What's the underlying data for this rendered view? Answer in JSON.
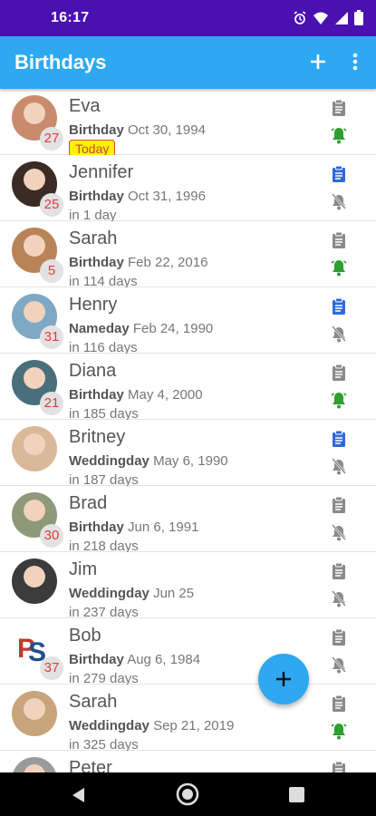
{
  "status": {
    "time": "16:17"
  },
  "app": {
    "title": "Birthdays"
  },
  "colors": {
    "appbar": "#2ea8f0",
    "statusbar": "#4a10b0",
    "bell_on": "#2e9e2e",
    "clip_blue": "#2d6bd8",
    "age": "#e43b3b",
    "today_bg": "#fff200"
  },
  "people": [
    {
      "name": "Eva",
      "age": "27",
      "event": "Birthday",
      "date": "Oct 30, 1994",
      "when": "",
      "today": "Today",
      "clip": "grey",
      "bell": "on",
      "avatar": "#c98b6c"
    },
    {
      "name": "Jennifer",
      "age": "25",
      "event": "Birthday",
      "date": "Oct 31, 1996",
      "when": "in 1 day",
      "today": "",
      "clip": "blue",
      "bell": "off",
      "avatar": "#3a2b25"
    },
    {
      "name": "Sarah",
      "age": "5",
      "event": "Birthday",
      "date": "Feb 22, 2016",
      "when": "in 114 days",
      "today": "",
      "clip": "grey",
      "bell": "on",
      "avatar": "#b98358"
    },
    {
      "name": "Henry",
      "age": "31",
      "event": "Nameday",
      "date": "Feb 24, 1990",
      "when": "in 116 days",
      "today": "",
      "clip": "blue",
      "bell": "off",
      "avatar": "#7fa8c4"
    },
    {
      "name": "Diana",
      "age": "21",
      "event": "Birthday",
      "date": "May 4, 2000",
      "when": "in 185 days",
      "today": "",
      "clip": "grey",
      "bell": "on",
      "avatar": "#4a6f7c"
    },
    {
      "name": "Britney",
      "age": "",
      "event": "Weddingday",
      "date": "May 6, 1990",
      "when": "in 187 days",
      "today": "",
      "clip": "blue",
      "bell": "off",
      "avatar": "#d9b99a"
    },
    {
      "name": "Brad",
      "age": "30",
      "event": "Birthday",
      "date": "Jun 6, 1991",
      "when": "in 218 days",
      "today": "",
      "clip": "grey",
      "bell": "off",
      "avatar": "#8c9a7a"
    },
    {
      "name": "Jim",
      "age": "",
      "event": "Weddingday",
      "date": "Jun 25",
      "when": "in 237 days",
      "today": "",
      "clip": "grey",
      "bell": "off",
      "avatar": "#3b3b3b"
    },
    {
      "name": "Bob",
      "age": "37",
      "event": "Birthday",
      "date": "Aug 6, 1984",
      "when": "in 279 days",
      "today": "",
      "clip": "grey",
      "bell": "off",
      "avatar": "#ffffff"
    },
    {
      "name": "Sarah",
      "age": "",
      "event": "Weddingday",
      "date": "Sep 21, 2019",
      "when": "in 325 days",
      "today": "",
      "clip": "grey",
      "bell": "on",
      "avatar": "#c8a47a"
    },
    {
      "name": "Peter",
      "age": "",
      "event": "",
      "date": "",
      "when": "",
      "today": "",
      "clip": "grey",
      "bell": "",
      "avatar": "#9a9a9a"
    }
  ]
}
